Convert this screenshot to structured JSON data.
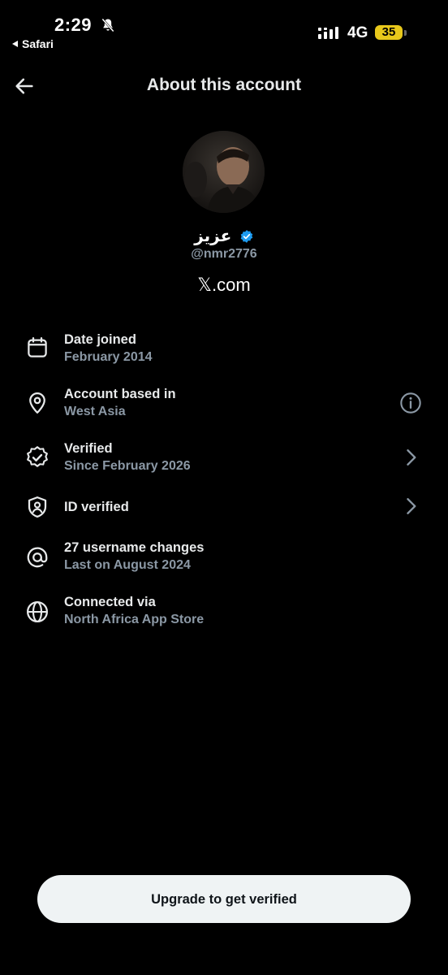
{
  "status_bar": {
    "time": "2:29",
    "back_app": "Safari",
    "network": "4G",
    "battery": "35"
  },
  "header": {
    "title": "About this account"
  },
  "profile": {
    "name": "عزيز",
    "handle": "@nmr2776",
    "domain": "𝕏.com"
  },
  "rows": [
    {
      "title": "Date joined",
      "subtitle": "February 2014",
      "icon": "calendar-icon"
    },
    {
      "title": "Account based in",
      "subtitle": "West Asia",
      "icon": "location-pin-icon",
      "right_icon": "info-icon"
    },
    {
      "title": "Verified",
      "subtitle": "Since February 2026",
      "icon": "verified-badge-icon",
      "right_icon": "chevron-right-icon"
    },
    {
      "title": "ID verified",
      "subtitle": "",
      "icon": "id-shield-icon",
      "right_icon": "chevron-right-icon"
    },
    {
      "title": "27 username changes",
      "subtitle": "Last on August 2024",
      "icon": "at-sign-icon"
    },
    {
      "title": "Connected via",
      "subtitle": "North Africa App Store",
      "icon": "globe-icon"
    }
  ],
  "footer": {
    "button_label": "Upgrade to get verified"
  },
  "colors": {
    "background": "#000000",
    "primary_text": "#e7e9ea",
    "secondary_text": "#8b98a5",
    "verified_blue": "#1d9bf0",
    "battery": "#e8c81b",
    "button_bg": "#eff3f4"
  }
}
